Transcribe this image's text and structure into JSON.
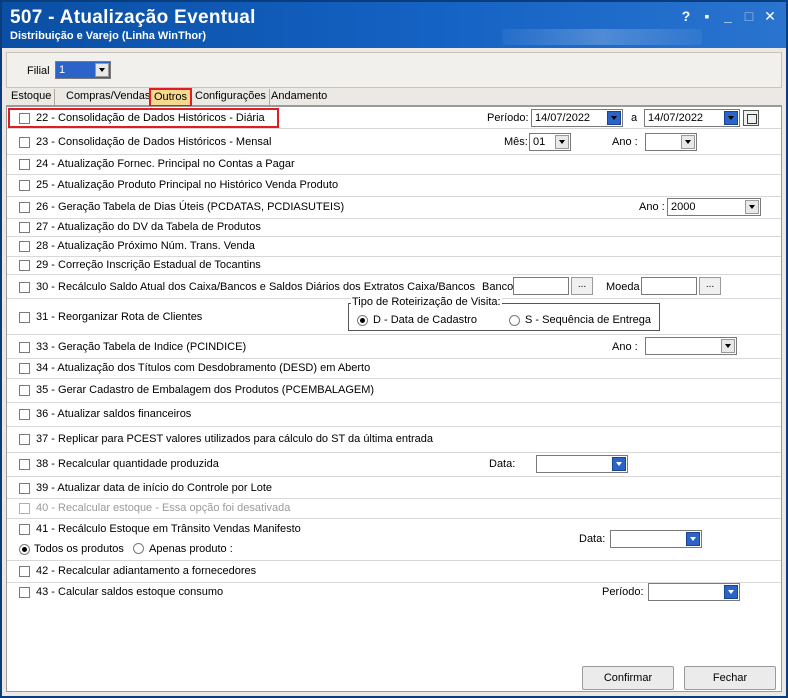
{
  "window": {
    "title": "507 - Atualização Eventual",
    "subtitle": "Distribuição e Varejo (Linha WinThor)",
    "help_icon": "?",
    "restore_icon": "▪",
    "minimize_icon": "_",
    "maximize_icon": "□",
    "close_icon": "✕"
  },
  "filial": {
    "label": "Filial",
    "value": "1"
  },
  "tabs": [
    "Estoque",
    "Compras/Vendas",
    "Outros",
    "Configurações",
    "Andamento"
  ],
  "active_tab": "Outros",
  "rows": [
    {
      "label": "22 - Consolidação de Dados Históricos - Diária"
    },
    {
      "label": "23 - Consolidação de Dados Históricos - Mensal"
    },
    {
      "label": "24 - Atualização Fornec. Principal no Contas a Pagar"
    },
    {
      "label": "25 - Atualização Produto Principal no Histórico Venda Produto"
    },
    {
      "label": "26 - Geração Tabela de Dias Úteis (PCDATAS, PCDIASUTEIS)"
    },
    {
      "label": "27 - Atualização do DV da Tabela de Produtos"
    },
    {
      "label": "28 - Atualização Próximo Núm. Trans. Venda"
    },
    {
      "label": "29 - Correção Inscrição Estadual de Tocantins"
    },
    {
      "label": "30 - Recálculo Saldo Atual dos Caixa/Bancos e Saldos Diários dos Extratos Caixa/Bancos"
    },
    {
      "label": "31 - Reorganizar Rota de Clientes"
    },
    {
      "label": "33 - Geração Tabela de Indice (PCINDICE)"
    },
    {
      "label": "34 - Atualização dos Títulos com Desdobramento (DESD) em Aberto"
    },
    {
      "label": "35 - Gerar Cadastro de Embalagem dos Produtos (PCEMBALAGEM)"
    },
    {
      "label": "36 - Atualizar saldos financeiros"
    },
    {
      "label": "37 - Replicar para PCEST valores utilizados para cálculo do ST da última entrada"
    },
    {
      "label": "38 - Recalcular quantidade produzida"
    },
    {
      "label": "39 - Atualizar data de início do Controle por Lote"
    },
    {
      "label": "40 - Recalcular estoque - Essa opção foi desativada"
    },
    {
      "label": "41 - Recálculo Estoque em Trânsito Vendas Manifesto"
    },
    {
      "label": "42 - Recalcular adiantamento a fornecedores"
    },
    {
      "label": "43 - Calcular saldos estoque consumo"
    }
  ],
  "r22": {
    "periodo_label": "Período:",
    "de": "14/07/2022",
    "a_label": "a",
    "ate": "14/07/2022"
  },
  "r23": {
    "mes_label": "Mês:",
    "mes": "01",
    "ano_label": "Ano :",
    "ano": ""
  },
  "r26": {
    "ano_label": "Ano :",
    "ano": "2000"
  },
  "r30": {
    "banco_label": "Banco",
    "moeda_label": "Moeda",
    "ellipsis": "..."
  },
  "r31": {
    "group_label": "Tipo de Roteirização de Visita:",
    "opt1": "D - Data de Cadastro",
    "opt2": "S - Sequência de Entrega",
    "selected": "D - Data de Cadastro"
  },
  "r33": {
    "ano_label": "Ano :"
  },
  "r38": {
    "data_label": "Data:"
  },
  "r41": {
    "opt1": "Todos os produtos",
    "opt2": "Apenas produto :",
    "selected": "Todos os produtos",
    "data_label": "Data:"
  },
  "r43": {
    "periodo_label": "Período:"
  },
  "buttons": {
    "confirmar": "Confirmar",
    "fechar": "Fechar"
  }
}
